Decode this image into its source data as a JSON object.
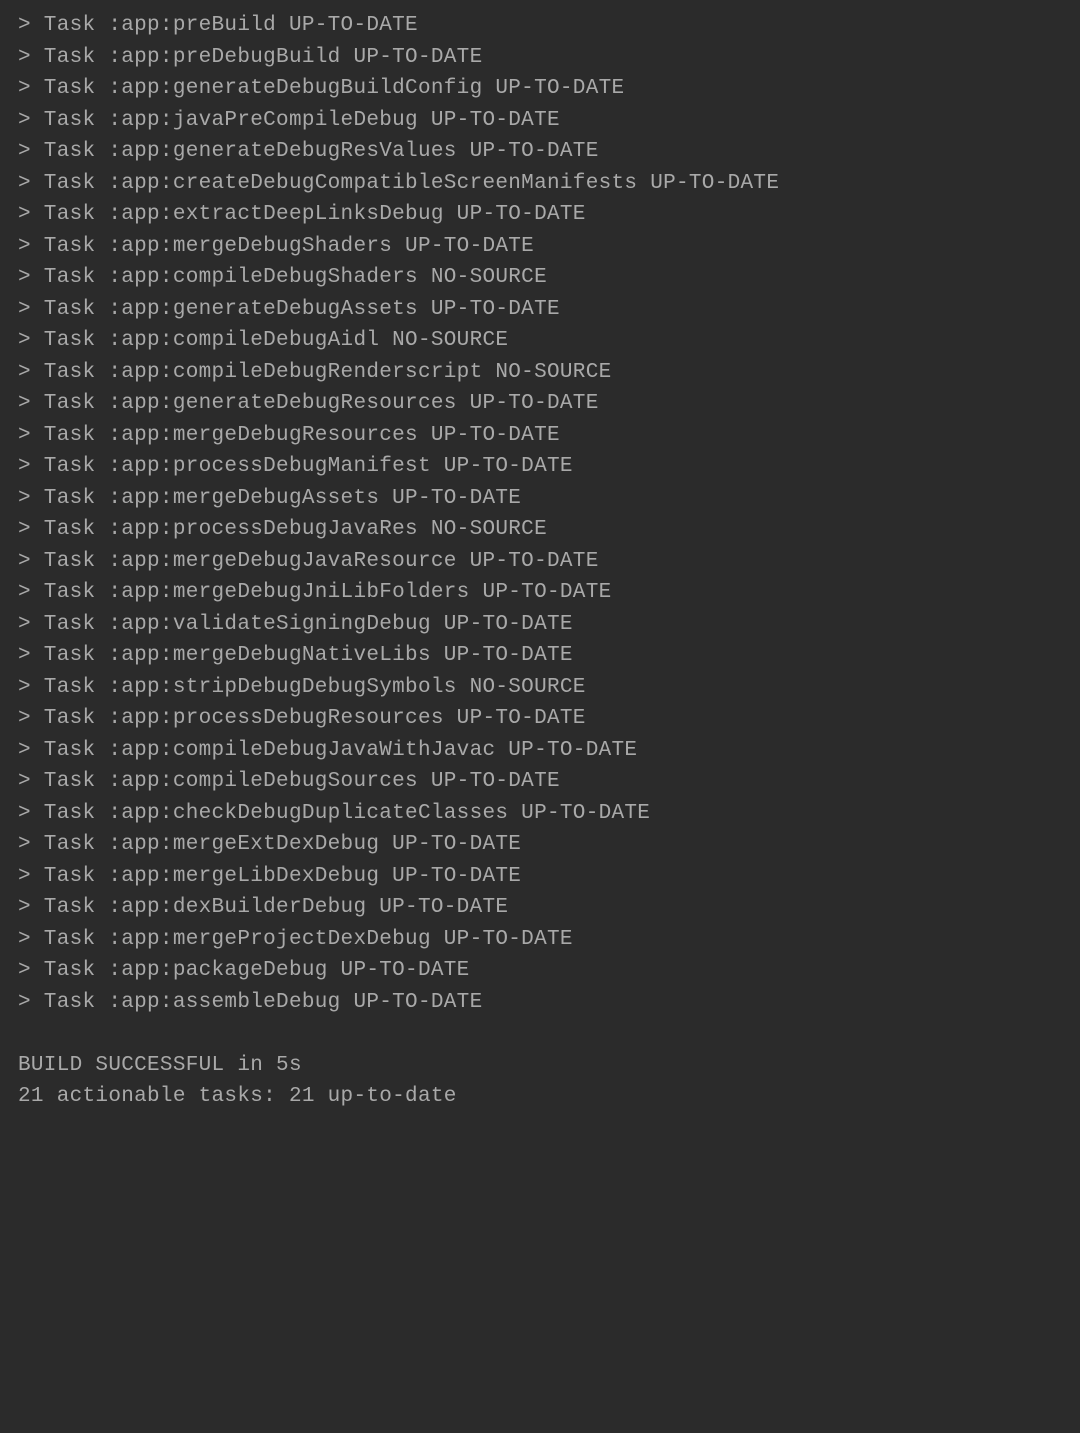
{
  "tasks": [
    {
      "name": ":app:preBuild",
      "status": "UP-TO-DATE"
    },
    {
      "name": ":app:preDebugBuild",
      "status": "UP-TO-DATE"
    },
    {
      "name": ":app:generateDebugBuildConfig",
      "status": "UP-TO-DATE"
    },
    {
      "name": ":app:javaPreCompileDebug",
      "status": "UP-TO-DATE"
    },
    {
      "name": ":app:generateDebugResValues",
      "status": "UP-TO-DATE"
    },
    {
      "name": ":app:createDebugCompatibleScreenManifests",
      "status": "UP-TO-DATE"
    },
    {
      "name": ":app:extractDeepLinksDebug",
      "status": "UP-TO-DATE"
    },
    {
      "name": ":app:mergeDebugShaders",
      "status": "UP-TO-DATE"
    },
    {
      "name": ":app:compileDebugShaders",
      "status": "NO-SOURCE"
    },
    {
      "name": ":app:generateDebugAssets",
      "status": "UP-TO-DATE"
    },
    {
      "name": ":app:compileDebugAidl",
      "status": "NO-SOURCE"
    },
    {
      "name": ":app:compileDebugRenderscript",
      "status": "NO-SOURCE"
    },
    {
      "name": ":app:generateDebugResources",
      "status": "UP-TO-DATE"
    },
    {
      "name": ":app:mergeDebugResources",
      "status": "UP-TO-DATE"
    },
    {
      "name": ":app:processDebugManifest",
      "status": "UP-TO-DATE"
    },
    {
      "name": ":app:mergeDebugAssets",
      "status": "UP-TO-DATE"
    },
    {
      "name": ":app:processDebugJavaRes",
      "status": "NO-SOURCE"
    },
    {
      "name": ":app:mergeDebugJavaResource",
      "status": "UP-TO-DATE"
    },
    {
      "name": ":app:mergeDebugJniLibFolders",
      "status": "UP-TO-DATE"
    },
    {
      "name": ":app:validateSigningDebug",
      "status": "UP-TO-DATE"
    },
    {
      "name": ":app:mergeDebugNativeLibs",
      "status": "UP-TO-DATE"
    },
    {
      "name": ":app:stripDebugDebugSymbols",
      "status": "NO-SOURCE"
    },
    {
      "name": ":app:processDebugResources",
      "status": "UP-TO-DATE"
    },
    {
      "name": ":app:compileDebugJavaWithJavac",
      "status": "UP-TO-DATE"
    },
    {
      "name": ":app:compileDebugSources",
      "status": "UP-TO-DATE"
    },
    {
      "name": ":app:checkDebugDuplicateClasses",
      "status": "UP-TO-DATE"
    },
    {
      "name": ":app:mergeExtDexDebug",
      "status": "UP-TO-DATE"
    },
    {
      "name": ":app:mergeLibDexDebug",
      "status": "UP-TO-DATE"
    },
    {
      "name": ":app:dexBuilderDebug",
      "status": "UP-TO-DATE"
    },
    {
      "name": ":app:mergeProjectDexDebug",
      "status": "UP-TO-DATE"
    },
    {
      "name": ":app:packageDebug",
      "status": "UP-TO-DATE"
    },
    {
      "name": ":app:assembleDebug",
      "status": "UP-TO-DATE"
    }
  ],
  "prefix": "> Task ",
  "summary": {
    "result_line": "BUILD SUCCESSFUL in 5s",
    "tasks_line": "21 actionable tasks: 21 up-to-date"
  }
}
